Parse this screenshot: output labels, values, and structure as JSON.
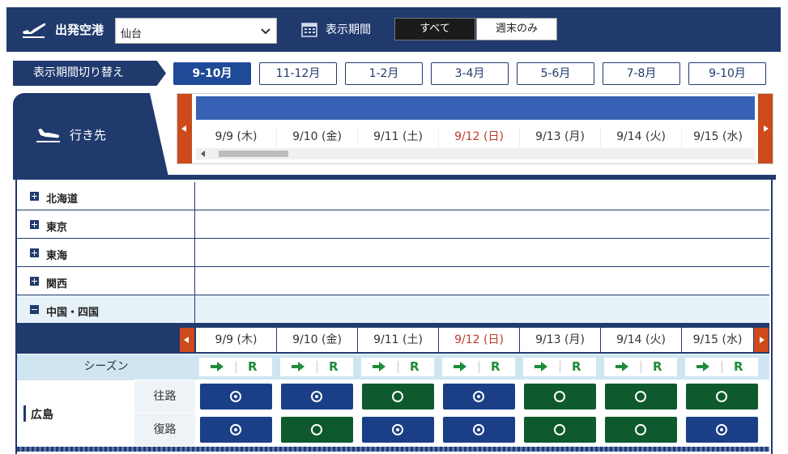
{
  "header": {
    "departure_label": "出発空港",
    "departure_value": "仙台",
    "period_label": "表示期間",
    "btn_all": "すべて",
    "btn_weekend": "週末のみ"
  },
  "period_switch": {
    "label": "表示期間切り替え",
    "tabs": [
      "9-10月",
      "11-12月",
      "1-2月",
      "3-4月",
      "5-6月",
      "7-8月",
      "9-10月"
    ],
    "active_index": 0
  },
  "destination_label": "行き先",
  "calendar_dates": [
    {
      "label": "9/9 (木)",
      "sunday": false
    },
    {
      "label": "9/10 (金)",
      "sunday": false
    },
    {
      "label": "9/11 (土)",
      "sunday": false
    },
    {
      "label": "9/12 (日)",
      "sunday": true
    },
    {
      "label": "9/13 (月)",
      "sunday": false
    },
    {
      "label": "9/14 (火)",
      "sunday": false
    },
    {
      "label": "9/15 (水)",
      "sunday": false
    }
  ],
  "regions": [
    {
      "label": "北海道",
      "expanded": false
    },
    {
      "label": "東京",
      "expanded": false
    },
    {
      "label": "東海",
      "expanded": false
    },
    {
      "label": "関西",
      "expanded": false
    },
    {
      "label": "中国・四国",
      "expanded": true
    }
  ],
  "season_label": "シーズン",
  "season_mark": "R",
  "city": {
    "name": "広島",
    "outbound_label": "往路",
    "return_label": "復路",
    "outbound": [
      "blue",
      "blue",
      "green",
      "blue",
      "green",
      "green",
      "green"
    ],
    "return": [
      "blue",
      "green",
      "blue",
      "blue",
      "green",
      "green",
      "blue"
    ]
  },
  "colors": {
    "navy": "#203a6e",
    "accent_blue": "#1f4a98",
    "sunday_red": "#c0392b",
    "available_blue": "#1a3f86",
    "available_green": "#0e5a2e",
    "season_green": "#1e8c3a",
    "scroll_arrow": "#cc4a1b"
  }
}
